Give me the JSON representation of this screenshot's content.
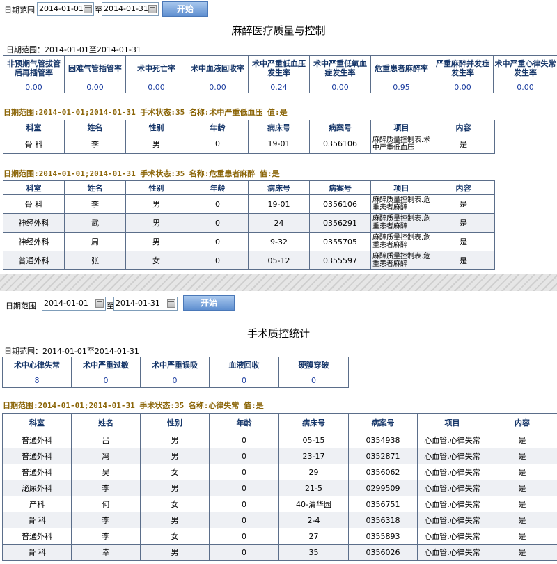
{
  "panel1": {
    "filter": {
      "label": "日期范围",
      "from": "2014-01-01",
      "sep": "至",
      "to": "2014-01-31",
      "button": "开始"
    },
    "title": "麻醉医疗质量与控制",
    "range_text": "日期范围：2014-01-01至2014-01-31",
    "headers": [
      "非预期气管拔管后再插管率",
      "困难气管插管率",
      "术中死亡率",
      "术中血液回收率",
      "术中严重低血压发生率",
      "术中严重低氧血症发生率",
      "危重患者麻醉率",
      "严重麻醉并发症发生率",
      "术中严重心律失常发生率"
    ],
    "values": [
      "0.00",
      "0.00",
      "0.00",
      "0.00",
      "0.24",
      "0.00",
      "0.95",
      "0.00",
      "0.00"
    ],
    "detail1": {
      "condition": "日期范围:2014-01-01;2014-01-31 手术状态:35 名称:术中严重低血压 值:是",
      "columns": [
        "科室",
        "姓名",
        "性别",
        "年龄",
        "病床号",
        "病案号",
        "项目",
        "内容"
      ],
      "rows": [
        [
          "骨 科",
          "李",
          "男",
          "0",
          "19-01",
          "0356106",
          "麻醉质量控制表.术中严重低血压",
          "是"
        ]
      ]
    },
    "detail2": {
      "condition": "日期范围:2014-01-01;2014-01-31 手术状态:35 名称:危重患者麻醉 值:是",
      "columns": [
        "科室",
        "姓名",
        "性别",
        "年龄",
        "病床号",
        "病案号",
        "项目",
        "内容"
      ],
      "rows": [
        [
          "骨 科",
          "李",
          "男",
          "0",
          "19-01",
          "0356106",
          "麻醉质量控制表.危重患者麻醉",
          "是"
        ],
        [
          "神经外科",
          "武",
          "男",
          "0",
          "24",
          "0356291",
          "麻醉质量控制表.危重患者麻醉",
          "是"
        ],
        [
          "神经外科",
          "周",
          "男",
          "0",
          "9-32",
          "0355705",
          "麻醉质量控制表.危重患者麻醉",
          "是"
        ],
        [
          "普通外科",
          "张",
          "女",
          "0",
          "05-12",
          "0355597",
          "麻醉质量控制表.危重患者麻醉",
          "是"
        ]
      ]
    }
  },
  "panel2": {
    "filter": {
      "label": "日期范围",
      "from": "2014-01-01",
      "sep": "至",
      "to": "2014-01-31",
      "button": "开始"
    },
    "title": "手术质控统计",
    "range_text": "日期范围：2014-01-01至2014-01-31",
    "headers": [
      "术中心律失常",
      "术中严重过敏",
      "术中严重误吸",
      "血液回收",
      "硬膜穿破"
    ],
    "values": [
      "8",
      "0",
      "0",
      "0",
      "0"
    ],
    "detail": {
      "condition": "日期范围:2014-01-01;2014-01-31 手术状态:35 名称:心律失常 值:是",
      "columns": [
        "科室",
        "姓名",
        "性别",
        "年龄",
        "病床号",
        "病案号",
        "项目",
        "内容"
      ],
      "rows": [
        [
          "普通外科",
          "吕",
          "男",
          "0",
          "05-15",
          "0354938",
          "心血管.心律失常",
          "是"
        ],
        [
          "普通外科",
          "冯",
          "男",
          "0",
          "23-17",
          "0352871",
          "心血管.心律失常",
          "是"
        ],
        [
          "普通外科",
          "吴",
          "女",
          "0",
          "29",
          "0356062",
          "心血管.心律失常",
          "是"
        ],
        [
          "泌尿外科",
          "李",
          "男",
          "0",
          "21-5",
          "0299509",
          "心血管.心律失常",
          "是"
        ],
        [
          "产科",
          "何",
          "女",
          "0",
          "40-清华园",
          "0356751",
          "心血管.心律失常",
          "是"
        ],
        [
          "骨 科",
          "李",
          "男",
          "0",
          "2-4",
          "0356318",
          "心血管.心律失常",
          "是"
        ],
        [
          "普通外科",
          "李",
          "女",
          "0",
          "27",
          "0355893",
          "心血管.心律失常",
          "是"
        ],
        [
          "骨 科",
          "幸",
          "男",
          "0",
          "35",
          "0356026",
          "心血管.心律失常",
          "是"
        ]
      ]
    }
  }
}
